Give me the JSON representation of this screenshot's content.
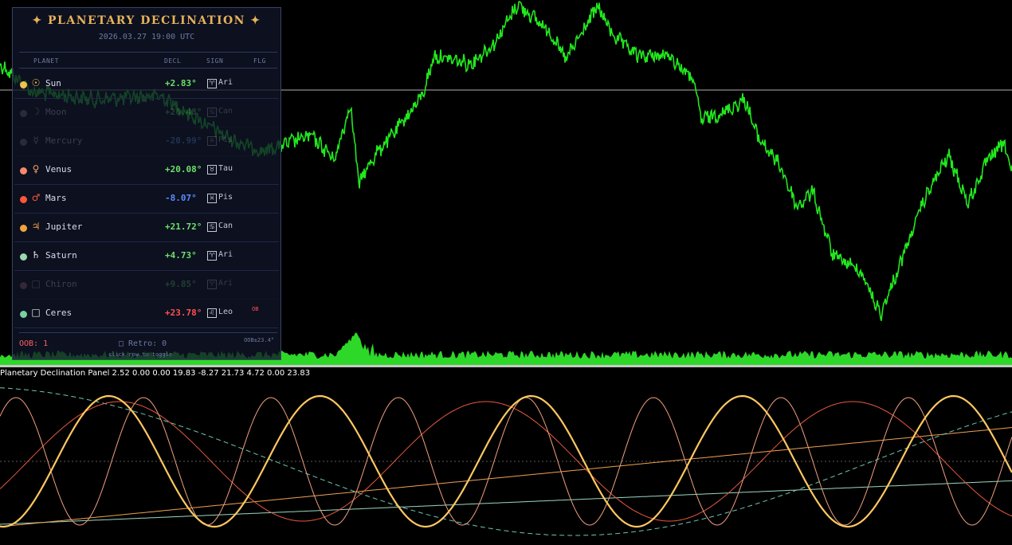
{
  "panel": {
    "title": "✦ PLANETARY DECLINATION ✦",
    "datetime": "2026.03.27 19:00 UTC",
    "columns": {
      "planet": "PLANET",
      "decl": "DECL",
      "sign": "SIGN",
      "flag": "FLG"
    },
    "rows": [
      {
        "symbol": "☉",
        "name": "Sun",
        "decl": "+2.83°",
        "sign_glyph": "♈",
        "sign": "Ari",
        "flag": "",
        "dim": false,
        "dot_color": "#f2c34b",
        "decl_color": "#6ee06a",
        "sym_color": "#f2c34b"
      },
      {
        "symbol": "☽",
        "name": "Moon",
        "decl": "+20.48°",
        "sign_glyph": "♋",
        "sign": "Can",
        "flag": "",
        "dim": true,
        "dot_color": "#8a8f9a",
        "decl_color": "#6ee06a",
        "sym_color": "#c8ccd8"
      },
      {
        "symbol": "☿",
        "name": "Mercury",
        "decl": "-20.99°",
        "sign_glyph": "♓",
        "sign": "Pis",
        "flag": "",
        "dim": true,
        "dot_color": "#8a8f9a",
        "decl_color": "#6aa6ff",
        "sym_color": "#c8ccd8"
      },
      {
        "symbol": "♀",
        "name": "Venus",
        "decl": "+20.08°",
        "sign_glyph": "♉",
        "sign": "Tau",
        "flag": "",
        "dim": false,
        "dot_color": "#f58a6a",
        "decl_color": "#6ee06a",
        "sym_color": "#f2a060"
      },
      {
        "symbol": "♂",
        "name": "Mars",
        "decl": "-8.07°",
        "sign_glyph": "♓",
        "sign": "Pis",
        "flag": "",
        "dim": false,
        "dot_color": "#ff5538",
        "decl_color": "#5a8cff",
        "sym_color": "#ff5538"
      },
      {
        "symbol": "♃",
        "name": "Jupiter",
        "decl": "+21.72°",
        "sign_glyph": "♋",
        "sign": "Can",
        "flag": "",
        "dim": false,
        "dot_color": "#f2a23c",
        "decl_color": "#6ee06a",
        "sym_color": "#f2a23c"
      },
      {
        "symbol": "♄",
        "name": "Saturn",
        "decl": "+4.73°",
        "sign_glyph": "♈",
        "sign": "Ari",
        "flag": "",
        "dim": false,
        "dot_color": "#9ad8b0",
        "decl_color": "#6ee06a",
        "sym_color": "#e8e8e8"
      },
      {
        "symbol": "□",
        "name": "Chiron",
        "decl": "+9.85°",
        "sign_glyph": "♈",
        "sign": "Ari",
        "flag": "",
        "dim": true,
        "dot_color": "#c87890",
        "decl_color": "#6ee06a",
        "sym_color": "#c8ccd8"
      },
      {
        "symbol": "□",
        "name": "Ceres",
        "decl": "+23.78°",
        "sign_glyph": "♌",
        "sign": "Leo",
        "flag": "OB",
        "dim": false,
        "dot_color": "#7ad0a0",
        "decl_color": "#ff5050",
        "sym_color": "#e8e8e8"
      }
    ],
    "footer": {
      "oob": "OOB: 1",
      "retro": "□ Retro: 0",
      "limit": "OOB±23.4°",
      "hint": "click row to toggle"
    }
  },
  "indicator": {
    "label": "Planetary Declination Panel 2.52 0.00 0.00 19.83 -8.27 21.73 4.72 0.00 23.83"
  },
  "colors": {
    "price": "#21e81e",
    "volume": "#2ed829",
    "background": "#000000",
    "panel_bg": "#101428",
    "title": "#e8b25a"
  }
}
